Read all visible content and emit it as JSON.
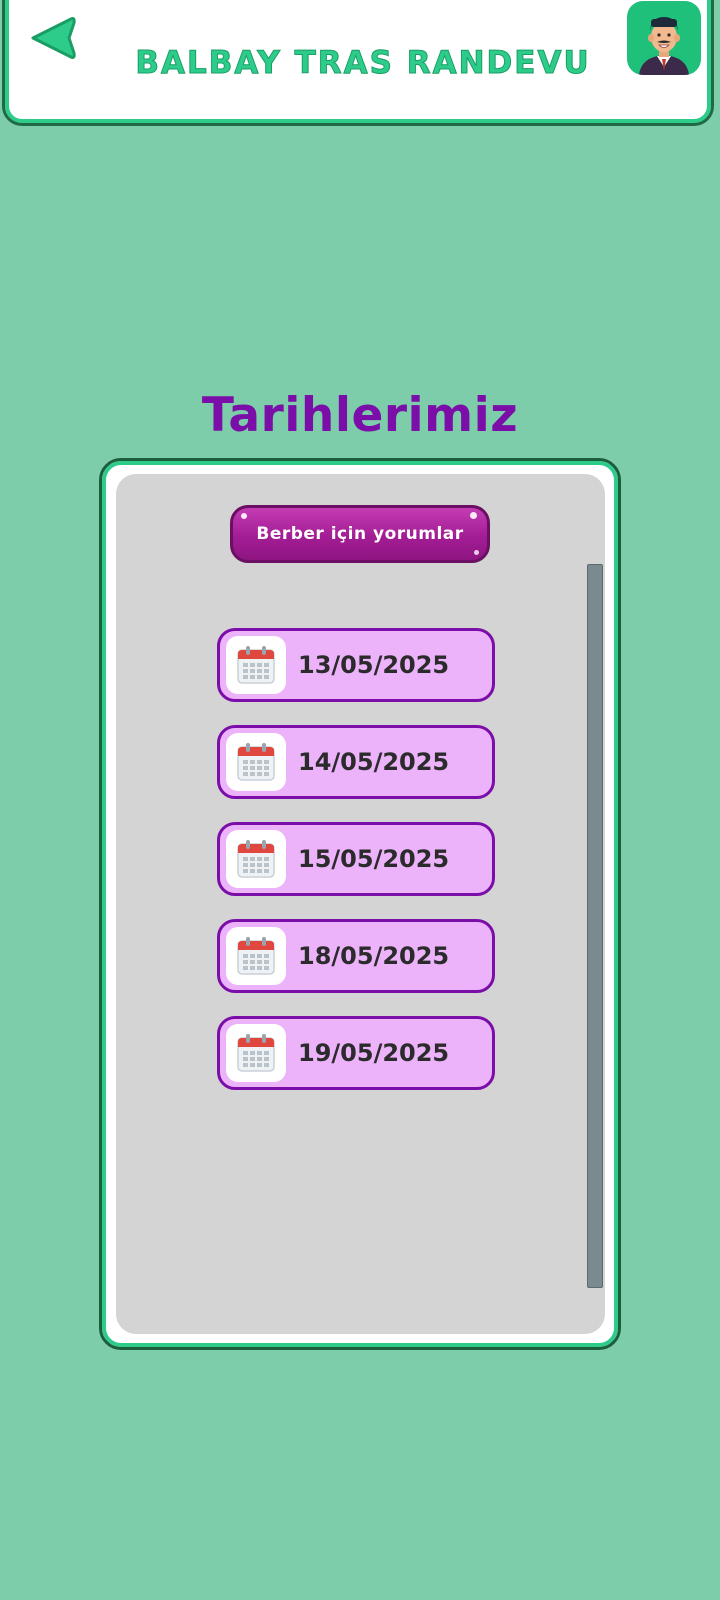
{
  "header": {
    "title": "BALBAY TRAS RANDEVU",
    "back_icon": "back-arrow-icon",
    "avatar_icon": "barber-avatar-icon"
  },
  "section": {
    "title": "Tarihlerimiz"
  },
  "comments_button": {
    "label": "Berber için yorumlar"
  },
  "dates": [
    {
      "label": "13/05/2025",
      "icon": "calendar-icon"
    },
    {
      "label": "14/05/2025",
      "icon": "calendar-icon"
    },
    {
      "label": "15/05/2025",
      "icon": "calendar-icon"
    },
    {
      "label": "18/05/2025",
      "icon": "calendar-icon"
    },
    {
      "label": "19/05/2025",
      "icon": "calendar-icon"
    }
  ],
  "colors": {
    "background": "#7dcdaa",
    "accent_green": "#2ecc8a",
    "title_purple": "#7b0ea8",
    "date_fill": "#ecb3fb",
    "button_magenta": "#a31d95",
    "panel_gray": "#d4d4d4"
  }
}
